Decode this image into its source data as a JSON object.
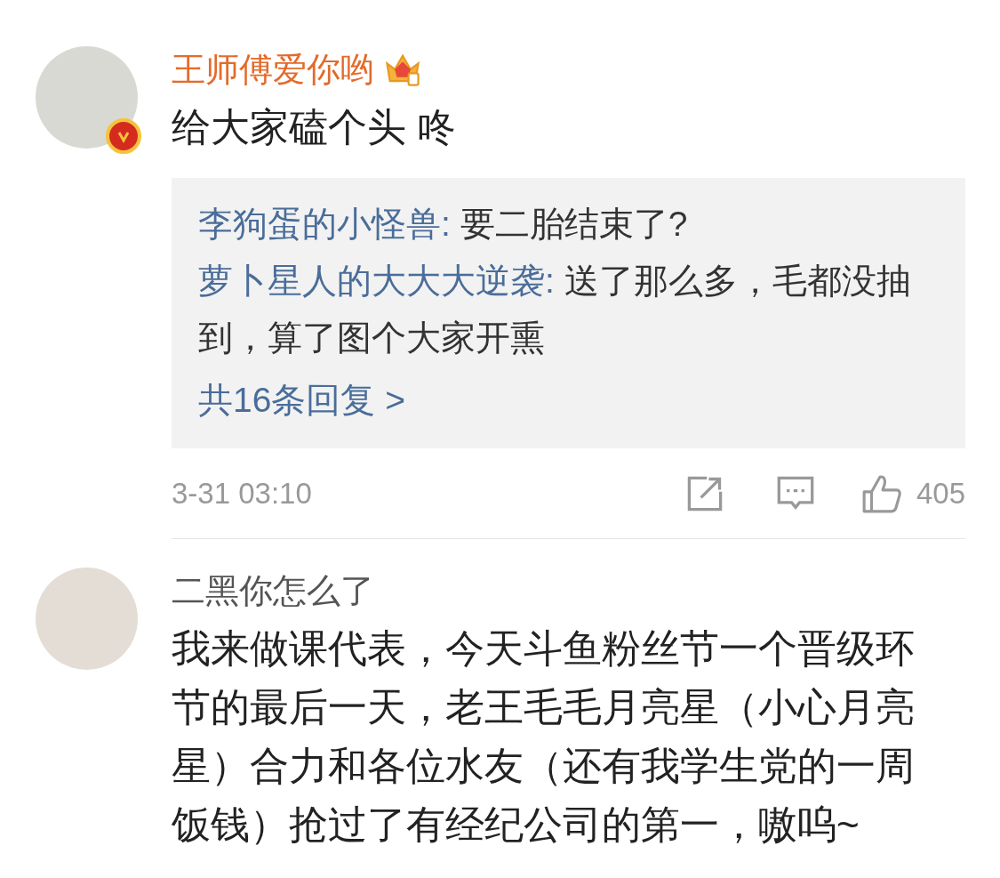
{
  "comments": [
    {
      "author": "王师傅爱你哟",
      "verified": true,
      "vip": true,
      "text": "给大家磕个头 咚",
      "replies": [
        {
          "author": "李狗蛋的小怪兽:",
          "text": "要二胎结束了?"
        },
        {
          "author": "萝卜星人的大大大逆袭:",
          "text": "送了那么多，毛都没抽到，算了图个大家开熏"
        }
      ],
      "more_replies": "共16条回复 >",
      "time": "3-31 03:10",
      "likes": "405"
    },
    {
      "author": "二黑你怎么了",
      "verified": false,
      "vip": false,
      "text": "我来做课代表，今天斗鱼粉丝节一个晋级环节的最后一天，老王毛毛月亮星（小心月亮星）合力和各位水友（还有我学生党的一周饭钱）抢过了有经纪公司的第一，嗷呜~"
    }
  ]
}
